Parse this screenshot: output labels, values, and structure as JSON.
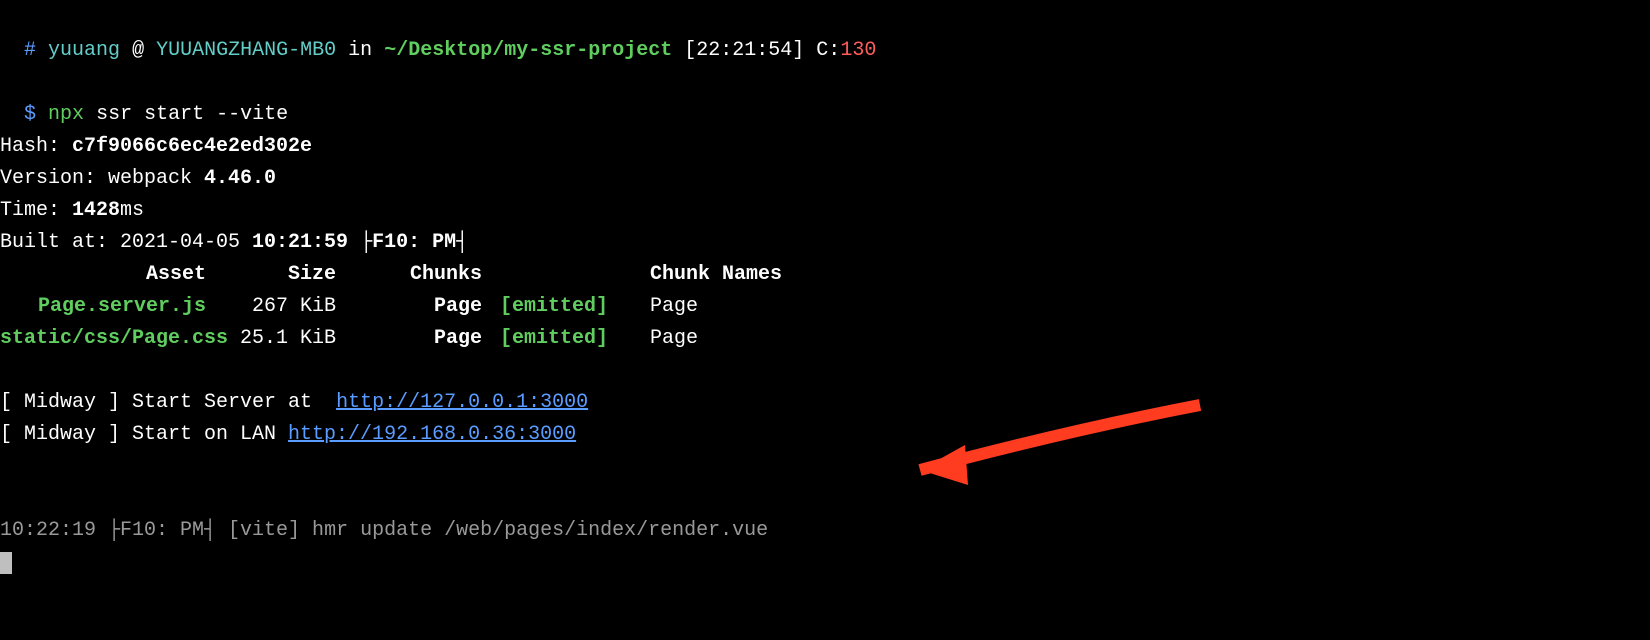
{
  "prompt": {
    "hash_symbol": "#",
    "user": "yuuang",
    "at": "@",
    "host": "YUUANGZHANG-MB0",
    "in_word": "in",
    "cwd": "~/Desktop/my-ssr-project",
    "time": "[22:21:54]",
    "c_label": "C:",
    "c_value": "130"
  },
  "command": {
    "dollar": "$",
    "cmd": "npx",
    "args": "ssr start --vite"
  },
  "build": {
    "hash_label": "Hash: ",
    "hash_value": "c7f9066c6ec4e2ed302e",
    "version_label": "Version: webpack ",
    "version_value": "4.46.0",
    "time_label": "Time: ",
    "time_value": "1428",
    "time_unit": "ms",
    "built_at_label": "Built at: 2021-04-05 ",
    "built_at_time": "10:21:59",
    "built_at_tz": " ├F10: PM┤"
  },
  "headers": {
    "asset": "Asset",
    "size": "Size",
    "chunks": "Chunks",
    "status": "",
    "names": "Chunk Names"
  },
  "rows": [
    {
      "asset": "Page.server.js",
      "size": "267 KiB",
      "chunks": "Page",
      "status": "[emitted]",
      "names": "Page"
    },
    {
      "asset": "static/css/Page.css",
      "size": "25.1 KiB",
      "chunks": "Page",
      "status": "[emitted]",
      "names": "Page"
    }
  ],
  "midway": {
    "line1_prefix": "[ Midway ] Start Server at  ",
    "line1_url": "http://127.0.0.1:3000",
    "line2_prefix": "[ Midway ] Start on LAN ",
    "line2_url": "http://192.168.0.36:3000"
  },
  "hmr": {
    "time": "10:22:19 ├F10: PM┤ ",
    "msg": "[vite] hmr update /web/pages/index/render.vue"
  }
}
